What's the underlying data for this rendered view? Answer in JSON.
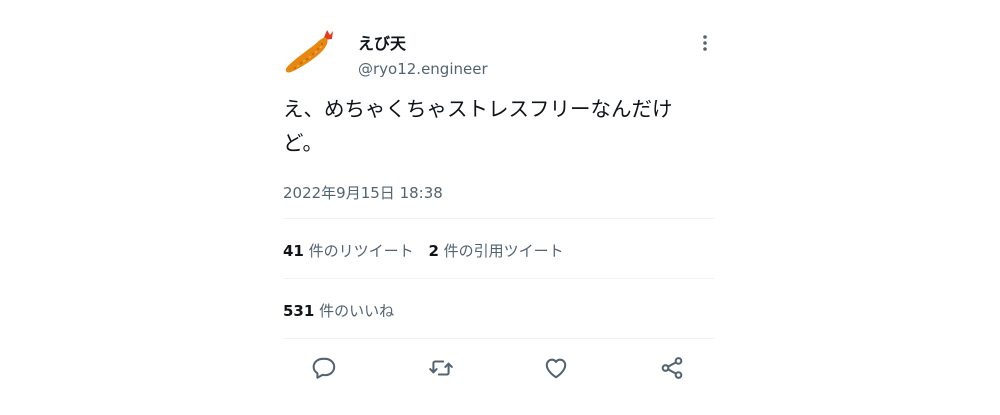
{
  "user": {
    "display_name": "えび天",
    "handle": "@ryo12.engineer",
    "avatar_icon": "fried-shrimp-icon"
  },
  "tweet": {
    "text_line1": "え、めちゃくちゃストレスフリーなんだけ",
    "text_line2": "ど。",
    "timestamp": "2022年9月15日 18:38"
  },
  "stats": {
    "retweets_count": "41",
    "retweets_label": "件のリツイート",
    "quotes_count": "2",
    "quotes_label": "件の引用ツイート",
    "likes_count": "531",
    "likes_label": "件のいいね"
  },
  "actions": {
    "reply_icon": "reply-icon",
    "retweet_icon": "retweet-icon",
    "like_icon": "heart-icon",
    "share_icon": "share-icon"
  },
  "colors": {
    "text": "#0f1419",
    "secondary": "#536471",
    "divider": "#eff3f4",
    "shrimp_body": "#e6870f",
    "shrimp_tail": "#e03c1e"
  }
}
